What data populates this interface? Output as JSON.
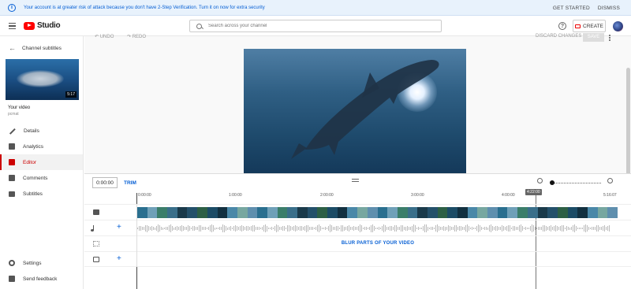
{
  "banner": {
    "message": "Your account is at greater risk of attack because you don't have 2-Step Verification. Turn it on now for extra security",
    "get_started": "GET STARTED",
    "dismiss": "DISMISS",
    "icon": "info-icon"
  },
  "header": {
    "logo_text": "Studio",
    "search_placeholder": "Search across your channel",
    "create_label": "CREATE"
  },
  "sidebar": {
    "back_label": "Channel subtitles",
    "thumb_duration": "5:17",
    "your_video": "Your video",
    "video_name": "pcmat",
    "items": [
      {
        "label": "Details",
        "icon": "pencil-icon"
      },
      {
        "label": "Analytics",
        "icon": "analytics-icon"
      },
      {
        "label": "Editor",
        "icon": "editor-icon",
        "active": true
      },
      {
        "label": "Comments",
        "icon": "comments-icon"
      },
      {
        "label": "Subtitles",
        "icon": "subtitles-icon"
      }
    ],
    "settings": "Settings",
    "feedback": "Send feedback"
  },
  "toolbar": {
    "undo": "UNDO",
    "redo": "REDO",
    "discard": "DISCARD CHANGES",
    "save": "SAVE"
  },
  "timeline": {
    "current_time": "0:00:00",
    "trim": "TRIM",
    "ticks": [
      "0:00:00",
      "1:00:00",
      "2:00:00",
      "3:00:00",
      "4:00:00",
      "5:16:07"
    ],
    "playhead": "4:22:00",
    "blur_label": "BLUR PARTS OF YOUR VIDEO",
    "add_symbol": "+"
  },
  "colors": {
    "accent": "#065fd4",
    "brand_red": "#ff0000",
    "active_red": "#cc0000"
  }
}
